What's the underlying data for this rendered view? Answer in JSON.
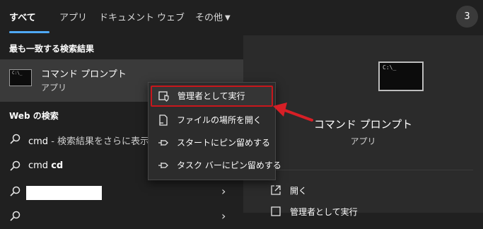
{
  "tabs": [
    {
      "label": "すべて",
      "active": true
    },
    {
      "label": "アプリ"
    },
    {
      "label": "ドキュメント"
    },
    {
      "label": "ウェブ"
    },
    {
      "label": "その他"
    }
  ],
  "badge": "3",
  "best_match": {
    "header": "最も一致する検索結果",
    "title": "コマンド プロンプト",
    "subtitle": "アプリ"
  },
  "web": {
    "header": "Web の検索",
    "rows": [
      {
        "query": "cmd",
        "suffix": " - 検索結果をさらに表示す"
      },
      {
        "query": "cmd ",
        "bold": "cd"
      },
      {
        "query": ""
      },
      {
        "query": ""
      }
    ]
  },
  "context_menu": [
    {
      "label": "管理者として実行",
      "icon": "shield-icon",
      "highlighted": true
    },
    {
      "label": "ファイルの場所を開く",
      "icon": "file-icon"
    },
    {
      "label": "スタートにピン留めする",
      "icon": "pin-icon"
    },
    {
      "label": "タスク バーにピン留めする",
      "icon": "pin-icon"
    }
  ],
  "preview": {
    "title": "コマンド プロンプト",
    "subtitle": "アプリ",
    "actions": [
      {
        "label": "開く",
        "icon": "open-icon"
      },
      {
        "label": "管理者として実行",
        "icon": "shield-icon"
      }
    ]
  },
  "colors": {
    "accent": "#4fa9f5",
    "highlight_border": "#c8171c",
    "callout_arrow": "#d71f26"
  }
}
